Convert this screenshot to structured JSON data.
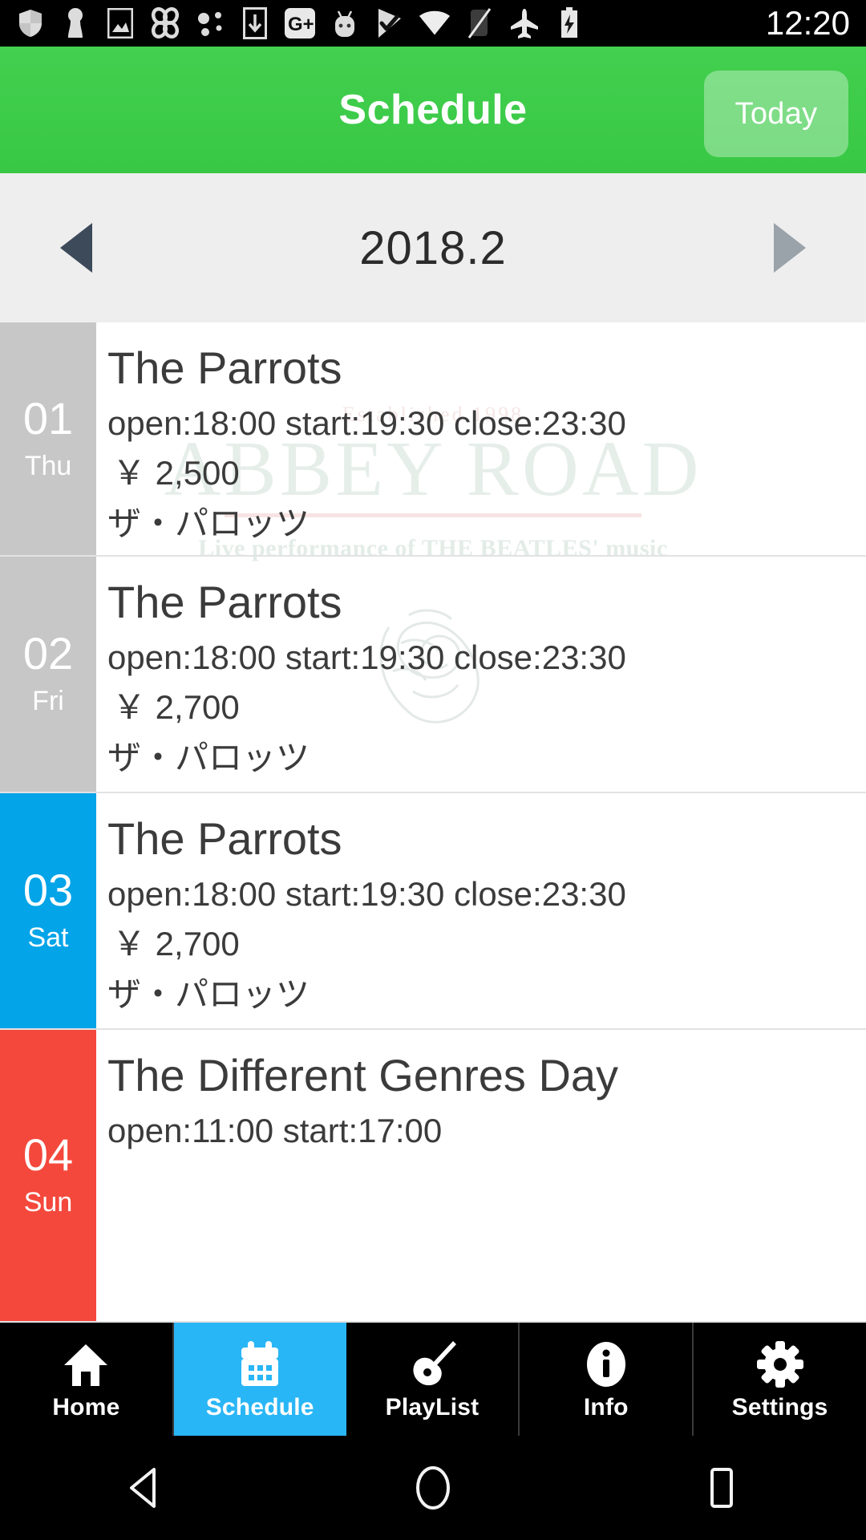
{
  "statusbar": {
    "icons": [
      "shield-icon",
      "keyhole-icon",
      "photo-icon",
      "pinwheel-icon",
      "dots-icon",
      "download-icon",
      "google-plus-icon",
      "android-icon",
      "checkmark-flag-icon",
      "wifi-icon",
      "no-sim-icon",
      "airplane-icon",
      "battery-charging-icon"
    ],
    "time": "12:20"
  },
  "appbar": {
    "title": "Schedule",
    "today_label": "Today",
    "accent_color": "#3ecc4a"
  },
  "monthbar": {
    "prev_label": "◀",
    "month_label": "2018.2",
    "next_label": "▶"
  },
  "watermark": {
    "established": "Established 1998",
    "name": "ABBEY ROAD",
    "subtitle": "Live performance of THE BEATLES' music"
  },
  "schedule": {
    "rows": [
      {
        "day": "01",
        "weekday": "Thu",
        "day_color": "#c7c7c7",
        "day_type": "weekday",
        "title": "The Parrots",
        "time": "open:18:00 start:19:30 close:23:30",
        "price": "￥ 2,500",
        "name_jp": "ザ・パロッツ"
      },
      {
        "day": "02",
        "weekday": "Fri",
        "day_color": "#c7c7c7",
        "day_type": "weekday",
        "title": "The Parrots",
        "time": "open:18:00 start:19:30 close:23:30",
        "price": "￥ 2,700",
        "name_jp": "ザ・パロッツ"
      },
      {
        "day": "03",
        "weekday": "Sat",
        "day_color": "#03a4e8",
        "day_type": "sat",
        "title": "The Parrots",
        "time": "open:18:00 start:19:30 close:23:30",
        "price": "￥ 2,700",
        "name_jp": "ザ・パロッツ"
      },
      {
        "day": "04",
        "weekday": "Sun",
        "day_color": "#f4483c",
        "day_type": "sun",
        "title": "The Different Genres Day",
        "time": "open:11:00 start:17:00",
        "price": "",
        "name_jp": ""
      }
    ]
  },
  "tabbar": {
    "tabs": [
      {
        "label": "Home",
        "icon": "home-icon",
        "active": false
      },
      {
        "label": "Schedule",
        "icon": "calendar-icon",
        "active": true
      },
      {
        "label": "PlayList",
        "icon": "guitar-icon",
        "active": false
      },
      {
        "label": "Info",
        "icon": "info-icon",
        "active": false
      },
      {
        "label": "Settings",
        "icon": "gear-icon",
        "active": false
      }
    ],
    "active_color": "#29b6f6"
  },
  "navbar": {
    "back": "back-icon",
    "home": "home-circle-icon",
    "recents": "recents-square-icon"
  }
}
